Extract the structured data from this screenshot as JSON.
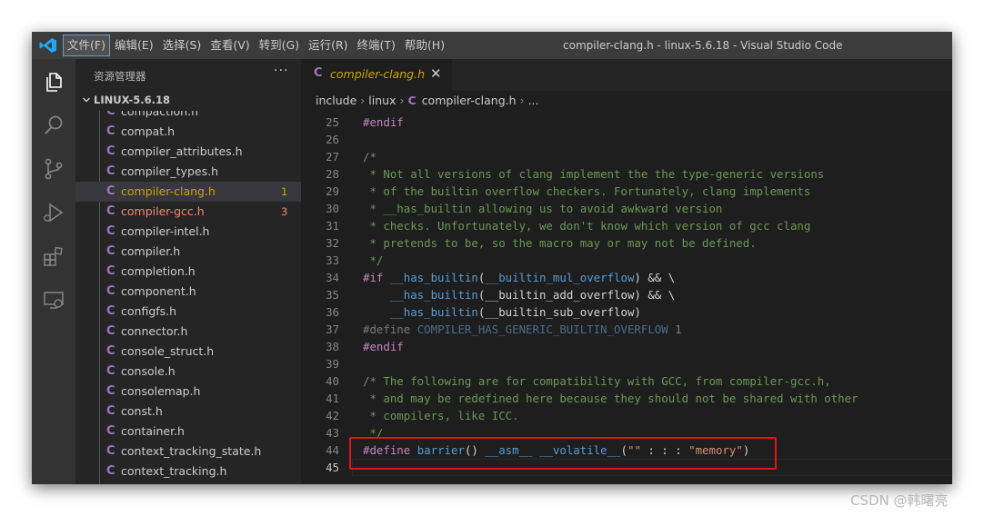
{
  "titlebar": {
    "menu": [
      "文件(F)",
      "编辑(E)",
      "选择(S)",
      "查看(V)",
      "转到(G)",
      "运行(R)",
      "终端(T)",
      "帮助(H)"
    ],
    "title": "compiler-clang.h - linux-5.6.18 - Visual Studio Code"
  },
  "activity_bar": {
    "icons": [
      "explorer-icon",
      "search-icon",
      "source-control-icon",
      "run-debug-icon",
      "extensions-icon",
      "remote-explorer-icon"
    ]
  },
  "sidebar": {
    "title": "资源管理器",
    "more": "···",
    "folder": "LINUX-5.6.18",
    "files": [
      {
        "name": "compaction.h",
        "status": "",
        "badge": ""
      },
      {
        "name": "compat.h",
        "status": "",
        "badge": ""
      },
      {
        "name": "compiler_attributes.h",
        "status": "",
        "badge": ""
      },
      {
        "name": "compiler_types.h",
        "status": "",
        "badge": ""
      },
      {
        "name": "compiler-clang.h",
        "status": "warn",
        "badge": "1"
      },
      {
        "name": "compiler-gcc.h",
        "status": "err",
        "badge": "3"
      },
      {
        "name": "compiler-intel.h",
        "status": "",
        "badge": ""
      },
      {
        "name": "compiler.h",
        "status": "",
        "badge": ""
      },
      {
        "name": "completion.h",
        "status": "",
        "badge": ""
      },
      {
        "name": "component.h",
        "status": "",
        "badge": ""
      },
      {
        "name": "configfs.h",
        "status": "",
        "badge": ""
      },
      {
        "name": "connector.h",
        "status": "",
        "badge": ""
      },
      {
        "name": "console_struct.h",
        "status": "",
        "badge": ""
      },
      {
        "name": "console.h",
        "status": "",
        "badge": ""
      },
      {
        "name": "consolemap.h",
        "status": "",
        "badge": ""
      },
      {
        "name": "const.h",
        "status": "",
        "badge": ""
      },
      {
        "name": "container.h",
        "status": "",
        "badge": ""
      },
      {
        "name": "context_tracking_state.h",
        "status": "",
        "badge": ""
      },
      {
        "name": "context_tracking.h",
        "status": "",
        "badge": ""
      }
    ]
  },
  "editor": {
    "tab": {
      "label": "compiler-clang.h",
      "close": "✕"
    },
    "breadcrumb": [
      "include",
      "linux",
      "compiler-clang.h",
      "..."
    ],
    "lines": [
      {
        "n": "25",
        "tokens": [
          [
            "kw",
            "#endif"
          ]
        ]
      },
      {
        "n": "26",
        "tokens": []
      },
      {
        "n": "27",
        "tokens": [
          [
            "cmt",
            "/*"
          ]
        ]
      },
      {
        "n": "28",
        "tokens": [
          [
            "cmt",
            " * Not all versions of clang implement the the type-generic versions"
          ]
        ]
      },
      {
        "n": "29",
        "tokens": [
          [
            "cmt",
            " * of the builtin overflow checkers. Fortunately, clang implements"
          ]
        ]
      },
      {
        "n": "30",
        "tokens": [
          [
            "cmt",
            " * __has_builtin allowing us to avoid awkward version"
          ]
        ]
      },
      {
        "n": "31",
        "tokens": [
          [
            "cmt",
            " * checks. Unfortunately, we don't know which version of gcc clang"
          ]
        ]
      },
      {
        "n": "32",
        "tokens": [
          [
            "cmt",
            " * pretends to be, so the macro may or may not be defined."
          ]
        ]
      },
      {
        "n": "33",
        "tokens": [
          [
            "cmt",
            " */"
          ]
        ]
      },
      {
        "n": "34",
        "tokens": [
          [
            "kw",
            "#if "
          ],
          [
            "mac",
            "__has_builtin"
          ],
          [
            "def",
            "("
          ],
          [
            "mac",
            "__builtin_mul_overflow"
          ],
          [
            "def",
            ") && \\"
          ]
        ]
      },
      {
        "n": "35",
        "tokens": [
          [
            "def",
            "    "
          ],
          [
            "mac",
            "__has_builtin"
          ],
          [
            "def",
            "("
          ],
          [
            "def",
            "__builtin_add_overflow"
          ],
          [
            "def",
            ") && \\"
          ]
        ]
      },
      {
        "n": "36",
        "tokens": [
          [
            "def",
            "    "
          ],
          [
            "mac",
            "__has_builtin"
          ],
          [
            "def",
            "("
          ],
          [
            "def",
            "__builtin_sub_overflow"
          ],
          [
            "def",
            ")"
          ]
        ]
      },
      {
        "n": "37",
        "tokens": [
          [
            "grey",
            "#define "
          ],
          [
            "greyb",
            "COMPILER_HAS_GENERIC_BUILTIN_OVERFLOW"
          ],
          [
            "num",
            " 1"
          ]
        ]
      },
      {
        "n": "38",
        "tokens": [
          [
            "kw",
            "#endif"
          ]
        ]
      },
      {
        "n": "39",
        "tokens": []
      },
      {
        "n": "40",
        "tokens": [
          [
            "cmt",
            "/* The following are for compatibility with GCC, from compiler-gcc.h,"
          ]
        ]
      },
      {
        "n": "41",
        "tokens": [
          [
            "cmt",
            " * and may be redefined here because they should not be shared with other"
          ]
        ]
      },
      {
        "n": "42",
        "tokens": [
          [
            "cmt",
            " * compilers, like ICC."
          ]
        ]
      },
      {
        "n": "43",
        "tokens": [
          [
            "cmt",
            " */"
          ]
        ]
      },
      {
        "n": "44",
        "tokens": [
          [
            "kw",
            "#define "
          ],
          [
            "mac",
            "barrier"
          ],
          [
            "def",
            "() "
          ],
          [
            "mac",
            "__asm__"
          ],
          [
            "def",
            " "
          ],
          [
            "mac",
            "__volatile__"
          ],
          [
            "def",
            "("
          ],
          [
            "str",
            "\"\""
          ],
          [
            "def",
            " : : : "
          ],
          [
            "str",
            "\"memory\""
          ],
          [
            "def",
            ")"
          ]
        ]
      },
      {
        "n": "45",
        "tokens": []
      }
    ],
    "current_line": "45"
  },
  "watermark": "CSDN @韩曙亮",
  "colors": {
    "highlight_box": "#e0151b",
    "warning": "#cca700",
    "error": "#f48771",
    "c_file_icon": "#a074c4"
  }
}
